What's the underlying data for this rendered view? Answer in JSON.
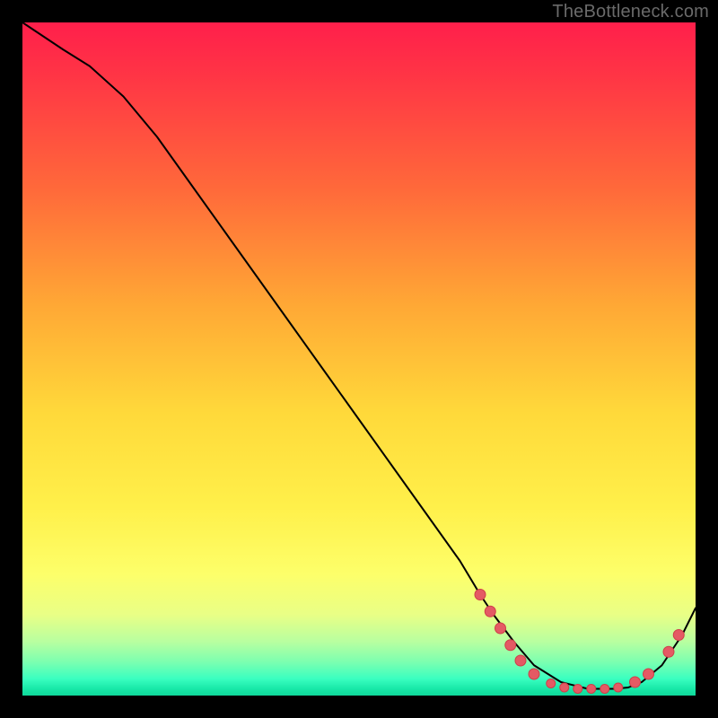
{
  "attribution": "TheBottleneck.com",
  "chart_data": {
    "type": "line",
    "title": "",
    "xlabel": "",
    "ylabel": "",
    "xlim": [
      0,
      100
    ],
    "ylim": [
      0,
      100
    ],
    "series": [
      {
        "name": "bottleneck-curve",
        "x": [
          0,
          3,
          6,
          10,
          15,
          20,
          25,
          30,
          35,
          40,
          45,
          50,
          55,
          60,
          65,
          68,
          70,
          73,
          76,
          80,
          84,
          88,
          90,
          92,
          95,
          98,
          100
        ],
        "y": [
          100,
          98,
          96,
          93.5,
          89,
          83,
          76,
          69,
          62,
          55,
          48,
          41,
          34,
          27,
          20,
          15,
          12,
          8,
          4.5,
          2,
          1,
          1,
          1.2,
          2,
          4.5,
          9,
          13
        ],
        "color": "#000000",
        "stroke_width": 2
      }
    ],
    "markers": [
      {
        "x": 68.0,
        "y": 15.0,
        "r": 6,
        "fill": "#e45a64",
        "stroke": "#cf3e49"
      },
      {
        "x": 69.5,
        "y": 12.5,
        "r": 6,
        "fill": "#e45a64",
        "stroke": "#cf3e49"
      },
      {
        "x": 71.0,
        "y": 10.0,
        "r": 6,
        "fill": "#e45a64",
        "stroke": "#cf3e49"
      },
      {
        "x": 72.5,
        "y": 7.5,
        "r": 6,
        "fill": "#e45a64",
        "stroke": "#cf3e49"
      },
      {
        "x": 74.0,
        "y": 5.2,
        "r": 6,
        "fill": "#e45a64",
        "stroke": "#cf3e49"
      },
      {
        "x": 76.0,
        "y": 3.2,
        "r": 6,
        "fill": "#e45a64",
        "stroke": "#cf3e49"
      },
      {
        "x": 78.5,
        "y": 1.8,
        "r": 5,
        "fill": "#e45a64",
        "stroke": "#cf3e49"
      },
      {
        "x": 80.5,
        "y": 1.2,
        "r": 5,
        "fill": "#e45a64",
        "stroke": "#cf3e49"
      },
      {
        "x": 82.5,
        "y": 1.0,
        "r": 5,
        "fill": "#e45a64",
        "stroke": "#cf3e49"
      },
      {
        "x": 84.5,
        "y": 1.0,
        "r": 5,
        "fill": "#e45a64",
        "stroke": "#cf3e49"
      },
      {
        "x": 86.5,
        "y": 1.0,
        "r": 5,
        "fill": "#e45a64",
        "stroke": "#cf3e49"
      },
      {
        "x": 88.5,
        "y": 1.2,
        "r": 5,
        "fill": "#e45a64",
        "stroke": "#cf3e49"
      },
      {
        "x": 91.0,
        "y": 2.0,
        "r": 6,
        "fill": "#e45a64",
        "stroke": "#cf3e49"
      },
      {
        "x": 93.0,
        "y": 3.2,
        "r": 6,
        "fill": "#e45a64",
        "stroke": "#cf3e49"
      },
      {
        "x": 96.0,
        "y": 6.5,
        "r": 6,
        "fill": "#e45a64",
        "stroke": "#cf3e49"
      },
      {
        "x": 97.5,
        "y": 9.0,
        "r": 6,
        "fill": "#e45a64",
        "stroke": "#cf3e49"
      }
    ],
    "colors": {
      "gradient_top": "#ff1f4b",
      "gradient_mid": "#ffd93a",
      "gradient_bottom": "#0fd89a",
      "marker_fill": "#e45a64",
      "marker_stroke": "#cf3e49",
      "curve": "#000000",
      "background": "#000000"
    }
  }
}
